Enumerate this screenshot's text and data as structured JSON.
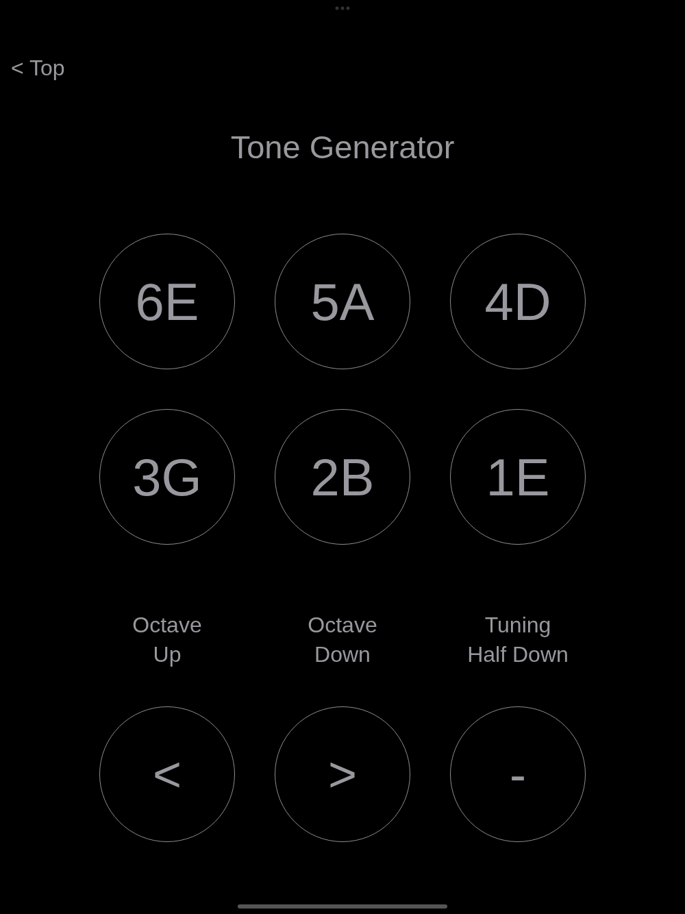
{
  "nav": {
    "back": "< Top"
  },
  "title": "Tone Generator",
  "notes": [
    {
      "label": "6E"
    },
    {
      "label": "5A"
    },
    {
      "label": "4D"
    },
    {
      "label": "3G"
    },
    {
      "label": "2B"
    },
    {
      "label": "1E"
    }
  ],
  "controls": [
    {
      "caption": "Octave\nUp",
      "label": "<"
    },
    {
      "caption": "Octave\nDown",
      "label": ">"
    },
    {
      "caption": "Tuning\nHalf Down",
      "label": "-"
    }
  ]
}
